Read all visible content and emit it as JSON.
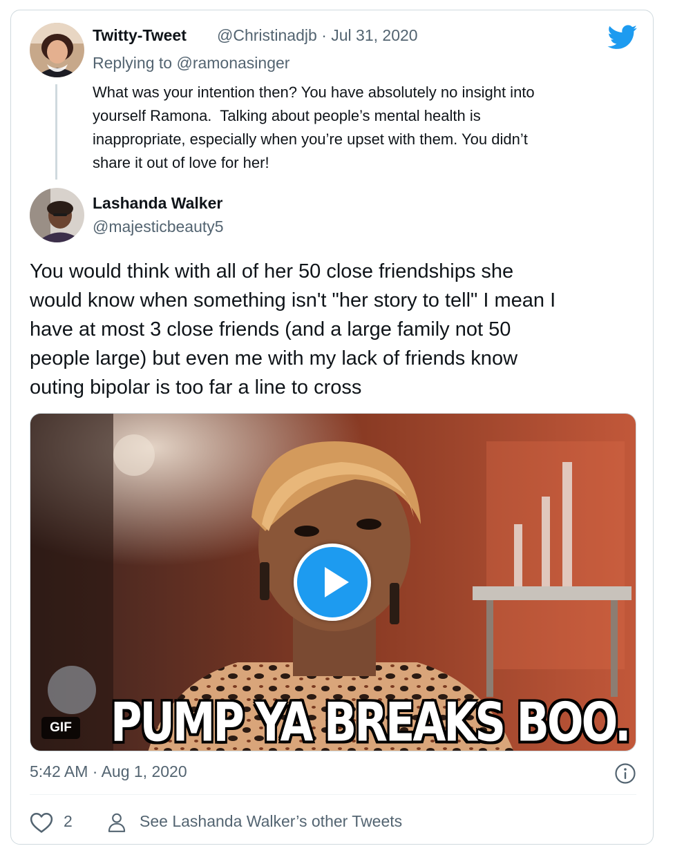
{
  "reply_tweet": {
    "display_name": "Twitty-Tweet",
    "handle": "@Christinadjb",
    "separator": "·",
    "date": "Jul 31, 2020",
    "replying_to_prefix": "Replying to",
    "replying_to_handle": "@ramonasinger",
    "text_lines": [
      "What was your intention then? You have absolutely no insight into",
      "yourself Ramona.  Talking about people’s mental health is",
      "inappropriate, especially when you’re upset with them. You didn’t",
      "share it out of love for her!"
    ]
  },
  "main_tweet": {
    "display_name": "Lashanda Walker",
    "handle": "@majesticbeauty5",
    "text_lines": [
      "You would think with all of her 50 close friendships she",
      "would know when something isn't \"her story to tell\" I mean I",
      "have at most 3 close friends (and a large family not 50",
      "people large) but even me with my lack of friends know",
      "outing bipolar is too far a line to cross"
    ],
    "media": {
      "badge": "GIF",
      "caption": "PUMP YA BREAKS BOO."
    },
    "time": "5:42 AM",
    "time_separator": "·",
    "date": "Aug 1, 2020"
  },
  "footer": {
    "like_count": "2",
    "other_tweets_label": "See Lashanda Walker’s other Tweets"
  },
  "colors": {
    "brand": "#1d9bf0",
    "text": "#0f1419",
    "muted": "#536471",
    "border": "#cfd9de"
  },
  "icons": {
    "brand": "twitter-bird-icon",
    "play": "play-icon",
    "info": "info-icon",
    "like": "heart-icon",
    "profile": "person-icon"
  }
}
